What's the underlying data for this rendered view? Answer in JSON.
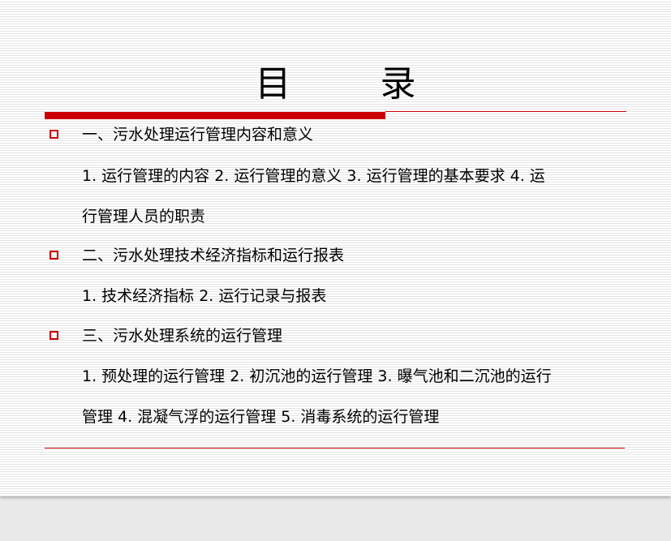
{
  "slide": {
    "title": "目录",
    "sections": [
      {
        "heading": "一、污水处理运行管理内容和意义",
        "detail_lines": [
          "1. 运行管理的内容  2. 运行管理的意义  3. 运行管理的基本要求  4. 运",
          "行管理人员的职责"
        ]
      },
      {
        "heading": "二、污水处理技术经济指标和运行报表",
        "detail_lines": [
          "1. 技术经济指标  2. 运行记录与报表"
        ]
      },
      {
        "heading": "三、污水处理系统的运行管理",
        "detail_lines": [
          "1. 预处理的运行管理  2. 初沉池的运行管理  3. 曝气池和二沉池的运行",
          "管理  4. 混凝气浮的运行管理  5. 消毒系统的运行管理"
        ]
      }
    ],
    "colors": {
      "accent": "#cc0000",
      "text": "#000000",
      "background": "#ffffff"
    },
    "bullet_icon": "hollow-square-icon"
  }
}
